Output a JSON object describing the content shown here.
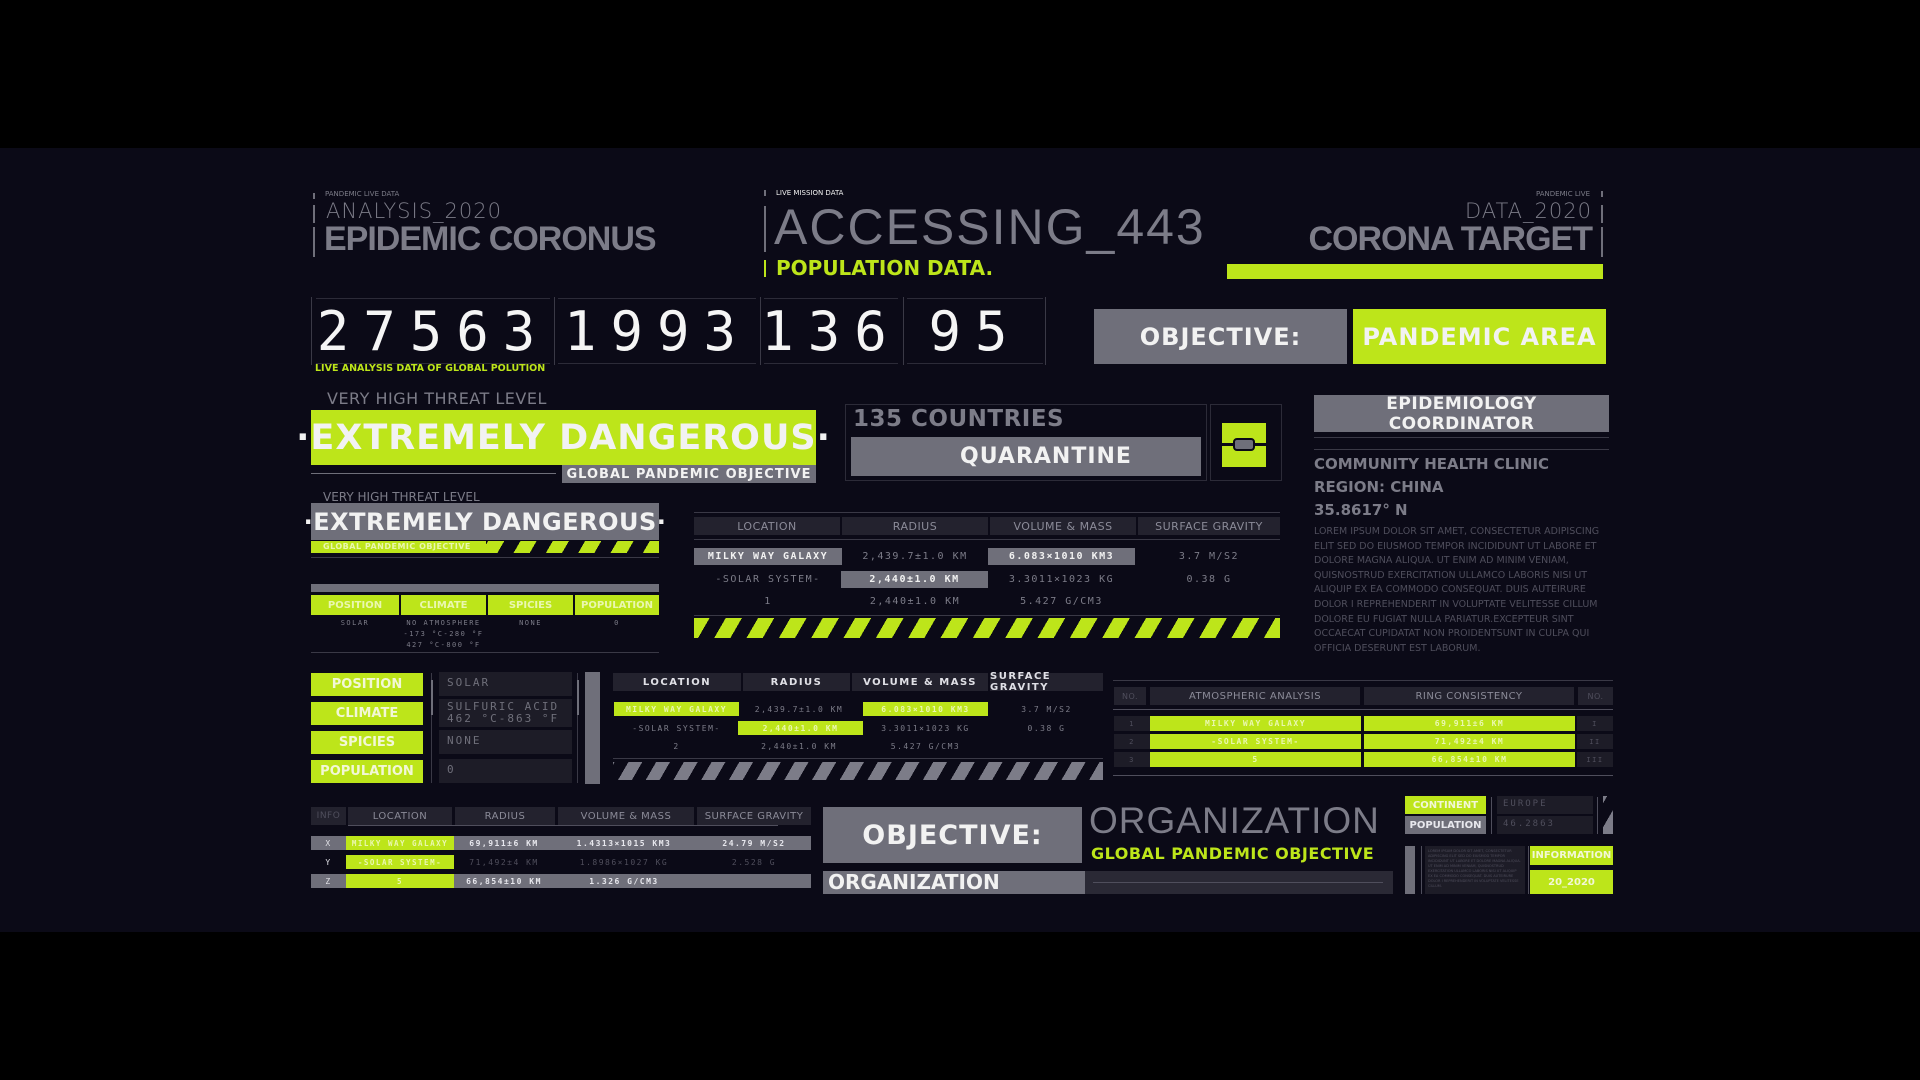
{
  "header_left": {
    "kicker": "PANDEMIC LIVE DATA",
    "subtitle": "ANALYSIS_2020",
    "title": "EPIDEMIC CORONUS"
  },
  "header_center": {
    "kicker": "LIVE MISSION DATA",
    "title": "ACCESSING_443",
    "subtitle": "POPULATION DATA."
  },
  "header_right": {
    "kicker": "PANDEMIC LIVE",
    "subtitle": "DATA_2020",
    "title": "CORONA TARGET",
    "progress_fraction": 1.0
  },
  "counters": {
    "values": [
      "27563",
      "1993",
      "136",
      "95"
    ],
    "caption": "LIVE ANALYSIS DATA OF GLOBAL POLUTION"
  },
  "objective_top": {
    "label": "OBJECTIVE:",
    "value": "PANDEMIC AREA"
  },
  "threat_large": {
    "level": "VERY HIGH THREAT LEVEL",
    "status": "·EXTREMELY DANGEROUS·",
    "tag": "GLOBAL PANDEMIC OBJECTIVE"
  },
  "threat_small": {
    "level": "VERY HIGH THREAT LEVEL",
    "status": "·EXTREMELY DANGEROUS·",
    "tag": "GLOBAL PANDEMIC OBJECTIVE"
  },
  "quarantine": {
    "countries": "135 COUNTRIES",
    "label": "QUARANTINE",
    "icon": "lock-icon"
  },
  "coordinator": {
    "title": "EPIDEMIOLOGY COORDINATOR",
    "line1": "COMMUNITY HEALTH CLINIC",
    "line2": "REGION: CHINA",
    "line3": "35.8617° N",
    "body": "LOREM IPSUM DOLOR SIT AMET, CONSECTETUR ADIPISCING ELIT SED DO EIUSMOD TEMPOR INCIDIDUNT UT LABORE ET DOLORE MAGNA ALIQUA. UT ENIM AD MINIM VENIAM, QUISNOSTRUD EXERCITATION ULLAMCO LABORIS NISI UT ALIQUIP EX EA COMMODO CONSEQUAT. DUIS AUTEIRURE DOLOR I REPREHENDERIT IN VOLUPTATE VELITESSE CILLUM DOLORE EU FUGIAT NULLA PARIATUR.EXCEPTEUR SINT OCCAECAT CUPIDATAT NON PROIDENTSUNT IN CULPA QUI OFFICIA DESERUNT EST LABORUM."
  },
  "stats_small": {
    "headers": [
      "POSITION",
      "CLIMATE",
      "SPICIES",
      "POPULATION"
    ],
    "values": [
      "SOLAR",
      "NO ATMOSPHERE",
      "NONE",
      "0"
    ],
    "climate_extra": [
      "-173 °C-280 °F",
      "427 °C-800 °F"
    ]
  },
  "table_upper": {
    "headers": [
      "LOCATION",
      "RADIUS",
      "VOLUME & MASS",
      "SURFACE GRAVITY"
    ],
    "rows": [
      [
        "MILKY WAY GALAXY",
        "2,439.7±1.0 KM",
        "6.083×1010 KM3",
        "3.7 M/S2"
      ],
      [
        "-SOLAR SYSTEM-",
        "2,440±1.0 KM",
        "3.3011×1023 KG",
        "0.38 G"
      ],
      [
        "1",
        "2,440±1.0 KM",
        "5.427 G/CM3",
        ""
      ]
    ]
  },
  "stats_list": {
    "items": [
      {
        "label": "POSITION",
        "value": "SOLAR"
      },
      {
        "label": "CLIMATE",
        "value": "SULFURIC ACID",
        "value2": "462 °C-863 °F"
      },
      {
        "label": "SPICIES",
        "value": "NONE"
      },
      {
        "label": "POPULATION",
        "value": "0"
      }
    ]
  },
  "table_middle": {
    "headers": [
      "LOCATION",
      "RADIUS",
      "VOLUME & MASS",
      "SURFACE GRAVITY"
    ],
    "rows": [
      [
        "MILKY WAY GALAXY",
        "2,439.7±1.0 KM",
        "6.083×1010 KM3",
        "3.7 M/S2"
      ],
      [
        "-SOLAR SYSTEM-",
        "2,440±1.0 KM",
        "3.3011×1023 KG",
        "0.38 G"
      ],
      [
        "2",
        "2,440±1.0 KM",
        "5.427 G/CM3",
        ""
      ]
    ]
  },
  "table_atmo": {
    "headers": [
      "NO.",
      "ATMOSPHERIC ANALYSIS",
      "RING CONSISTENCY",
      "NO."
    ],
    "rows": [
      [
        "1",
        "MILKY WAY GALAXY",
        "69,911±6 KM",
        "I"
      ],
      [
        "2",
        "-SOLAR SYSTEM-",
        "71,492±4 KM",
        "II"
      ],
      [
        "3",
        "5",
        "66,854±10 KM",
        "III"
      ]
    ]
  },
  "table_bottom": {
    "headers": [
      "INFO",
      "LOCATION",
      "RADIUS",
      "VOLUME & MASS",
      "SURFACE GRAVITY"
    ],
    "rows": [
      [
        "X",
        "MILKY WAY GALAXY",
        "69,911±6 KM",
        "1.4313×1015 KM3",
        "24.79 M/S2"
      ],
      [
        "Y",
        "-SOLAR SYSTEM-",
        "71,492±4 KM",
        "1.8986×1027 KG",
        "2.528 G"
      ],
      [
        "Z",
        "5",
        "66,854±10 KM",
        "1.326 G/CM3",
        ""
      ]
    ]
  },
  "objective_bottom": {
    "label": "OBJECTIVE:",
    "title": "ORGANIZATION",
    "subtitle": "GLOBAL PANDEMIC OBJECTIVE",
    "bar_label": "ORGANIZATION"
  },
  "info_box": {
    "continent_label": "CONTINENT",
    "continent_value": "EUROPE",
    "population_label": "POPULATION",
    "population_value": "46.2863",
    "info_label": "INFORMATION",
    "info_value": "20_2020",
    "body": "LOREM IPSUM DOLOR SIT AMET, CONSECTETUR ADIPISCING ELIT SED DO EIUSMOD TEMPOR INCIDIDUNT UT LABORE ET DOLORE MAGNA ALIQUA. UT ENIM AD MINIM VENIAM, QUISNOSTRUD EXERCITATION ULLAMCO LABORIS NISI UT ALIQUIP EX EA COMMODO CONSEQUAT. DUIS AUTEIRURE DOLOR I REPREHENDERIT IN VOLUPTATE VELITESSE CILLUM."
  },
  "colors": {
    "accent": "#bde51a",
    "grey": "#6f6f7a",
    "background": "#0b0a17"
  }
}
